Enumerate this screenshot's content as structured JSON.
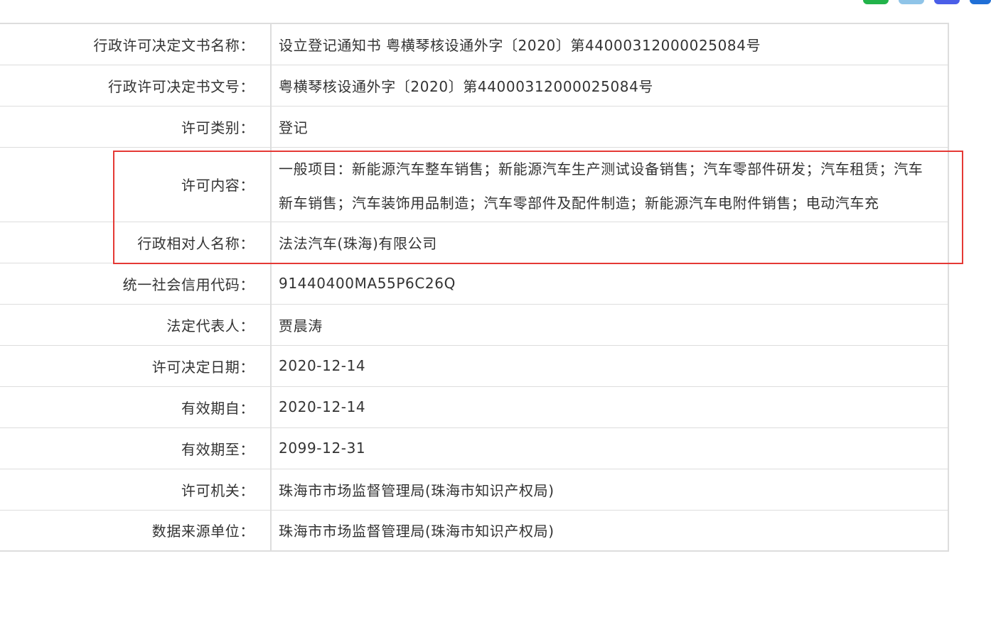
{
  "rows": [
    {
      "label": "行政许可决定文书名称：",
      "value": "设立登记通知书 粤横琴核设通外字〔2020〕第44000312000025084号"
    },
    {
      "label": "行政许可决定书文号：",
      "value": "粤横琴核设通外字〔2020〕第44000312000025084号"
    },
    {
      "label": "许可类别：",
      "value": "登记"
    },
    {
      "label": "许可内容：",
      "value": "一般项目：新能源汽车整车销售；新能源汽车生产测试设备销售；汽车零部件研发；汽车租赁；汽车新车销售；汽车装饰用品制造；汽车零部件及配件制造；新能源汽车电附件销售；电动汽车充"
    },
    {
      "label": "行政相对人名称：",
      "value": "法法汽车(珠海)有限公司"
    },
    {
      "label": "统一社会信用代码：",
      "value": "91440400MA55P6C26Q"
    },
    {
      "label": "法定代表人：",
      "value": "贾晨涛"
    },
    {
      "label": "许可决定日期：",
      "value": "2020-12-14"
    },
    {
      "label": "有效期自：",
      "value": "2020-12-14"
    },
    {
      "label": "有效期至：",
      "value": "2099-12-31"
    },
    {
      "label": "许可机关：",
      "value": "珠海市市场监督管理局(珠海市知识产权局)"
    },
    {
      "label": "数据来源单位：",
      "value": "珠海市市场监督管理局(珠海市知识产权局)"
    }
  ],
  "colors": {
    "highlight": "#e53935",
    "border": "#dddddd",
    "text": "#333333"
  },
  "share_icons": [
    "wechat-icon",
    "qzone-icon",
    "qq-icon",
    "weibo-icon"
  ]
}
